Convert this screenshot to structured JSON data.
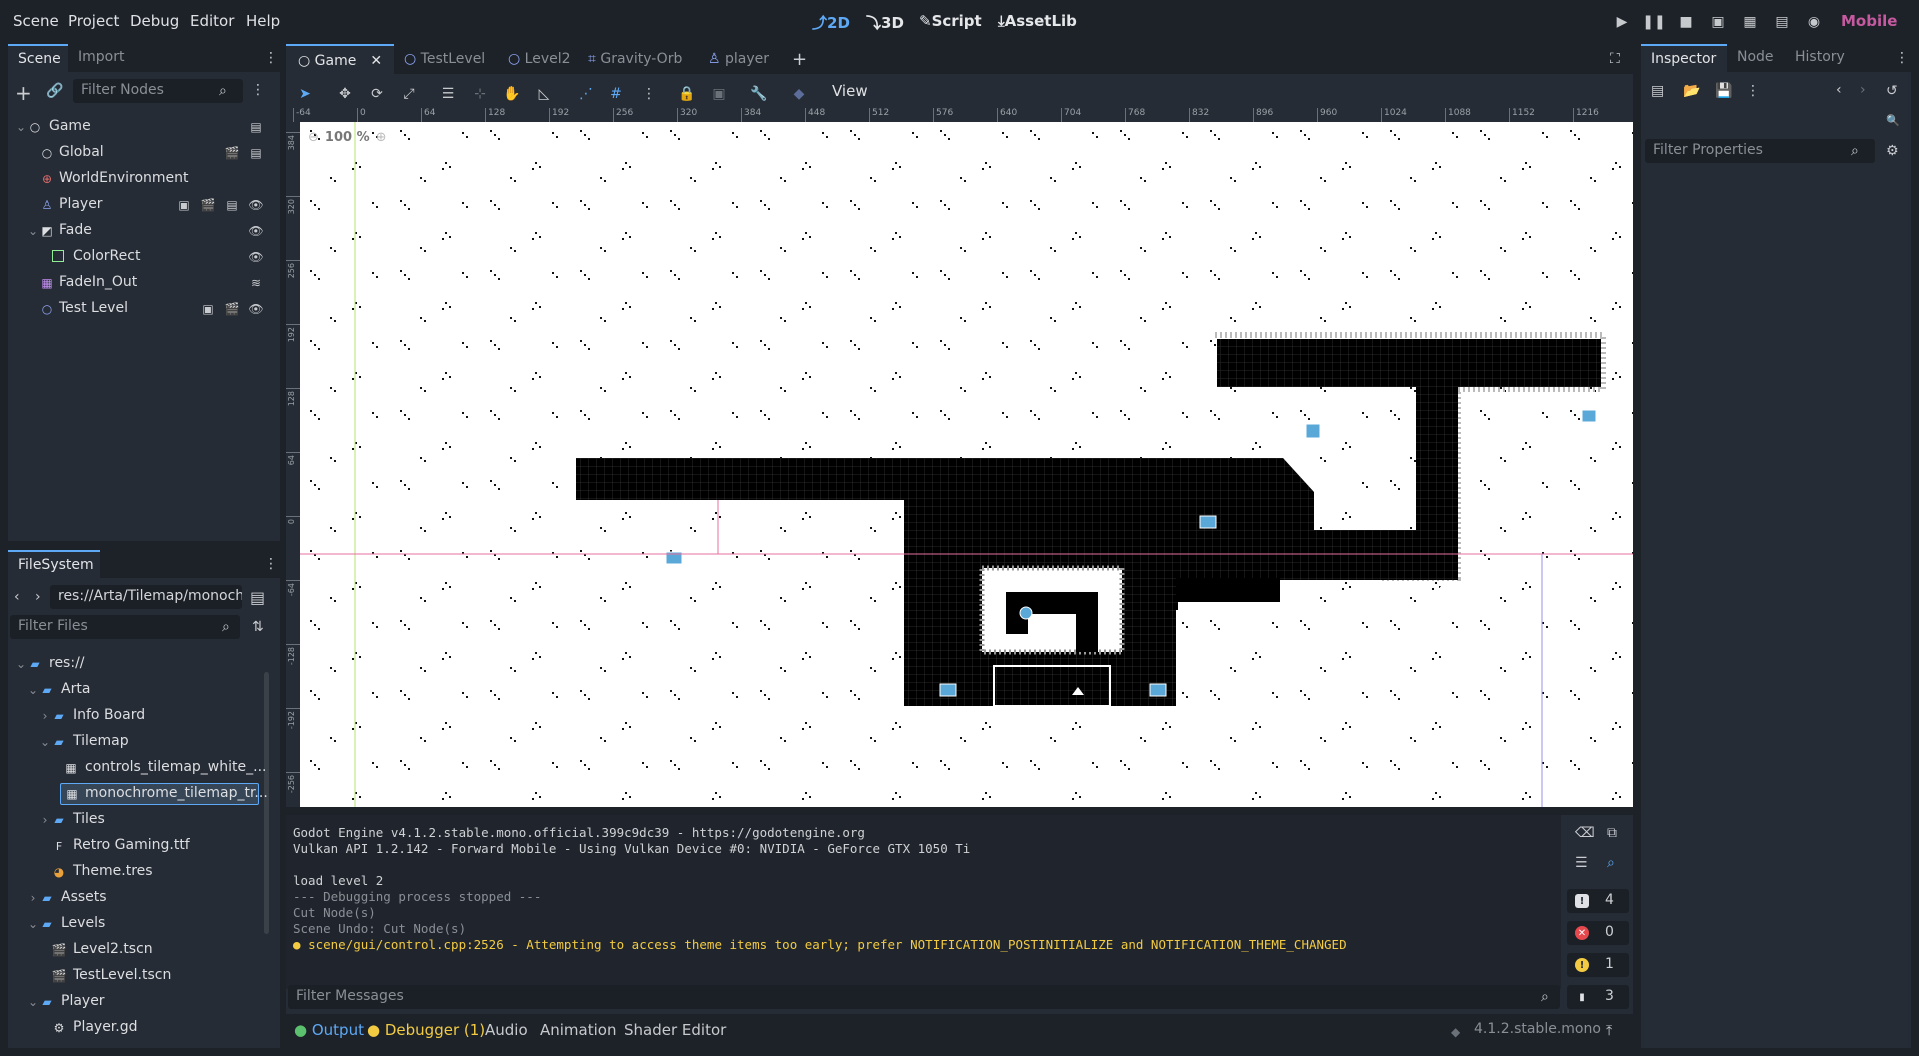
{
  "menu": [
    "Scene",
    "Project",
    "Debug",
    "Editor",
    "Help"
  ],
  "workspaces": {
    "w2d": "2D",
    "w3d": "3D",
    "script": "Script",
    "assetlib": "AssetLib"
  },
  "renderer": "Mobile",
  "scene_dock": {
    "tabs": [
      "Scene",
      "Import"
    ],
    "filter_placeholder": "Filter Nodes",
    "nodes": [
      {
        "label": "Game",
        "depth": 0
      },
      {
        "label": "Global",
        "depth": 1
      },
      {
        "label": "WorldEnvironment",
        "depth": 1
      },
      {
        "label": "Player",
        "depth": 1
      },
      {
        "label": "Fade",
        "depth": 1
      },
      {
        "label": "ColorRect",
        "depth": 2
      },
      {
        "label": "FadeIn_Out",
        "depth": 1
      },
      {
        "label": "Test Level",
        "depth": 1
      }
    ]
  },
  "filesystem": {
    "tab": "FileSystem",
    "path": "res://Arta/Tilemap/monoch",
    "filter_placeholder": "Filter Files",
    "items": [
      {
        "label": "res://"
      },
      {
        "label": "Arta"
      },
      {
        "label": "Info Board"
      },
      {
        "label": "Tilemap"
      },
      {
        "label": "controls_tilemap_white_..."
      },
      {
        "label": "monochrome_tilemap_tr..."
      },
      {
        "label": "Tiles"
      },
      {
        "label": "Retro Gaming.ttf"
      },
      {
        "label": "Theme.tres"
      },
      {
        "label": "Assets"
      },
      {
        "label": "Levels"
      },
      {
        "label": "Level2.tscn"
      },
      {
        "label": "TestLevel.tscn"
      },
      {
        "label": "Player"
      },
      {
        "label": "Player.gd"
      }
    ]
  },
  "editor_tabs": [
    "Game",
    "TestLevel",
    "Level2",
    "Gravity-Orb",
    "player"
  ],
  "toolbar": {
    "view_label": "View"
  },
  "zoom": "100 %",
  "ruler": {
    "top": [
      "-64",
      "0",
      "64",
      "128",
      "192",
      "256",
      "320",
      "384",
      "448",
      "512",
      "576",
      "640",
      "704",
      "768",
      "832",
      "896",
      "960",
      "1024",
      "1088",
      "1152",
      "1216"
    ],
    "left": [
      "384",
      "320",
      "256",
      "192",
      "128",
      "64",
      "0",
      "-64",
      "-128",
      "-192",
      "-256"
    ]
  },
  "inspector": {
    "tabs": [
      "Inspector",
      "Node",
      "History"
    ],
    "filter_placeholder": "Filter Properties"
  },
  "output": {
    "lines": [
      {
        "text": "Godot Engine v4.1.2.stable.mono.official.399c9dc39 - https://godotengine.org",
        "kind": "normal"
      },
      {
        "text": "Vulkan API 1.2.142 - Forward Mobile - Using Vulkan Device #0: NVIDIA - GeForce GTX 1050 Ti",
        "kind": "normal"
      },
      {
        "text": "",
        "kind": "normal"
      },
      {
        "text": "load level 2",
        "kind": "normal"
      },
      {
        "text": "--- Debugging process stopped ---",
        "kind": "dim"
      },
      {
        "text": "Cut Node(s)",
        "kind": "dim"
      },
      {
        "text": "Scene Undo: Cut Node(s)",
        "kind": "dim"
      },
      {
        "text": "scene/gui/control.cpp:2526 - Attempting to access theme items too early; prefer NOTIFICATION_POSTINITIALIZE and NOTIFICATION_THEME_CHANGED",
        "kind": "warning"
      }
    ],
    "filter_placeholder": "Filter Messages",
    "counters": {
      "messages": "4",
      "errors": "0",
      "warnings": "1",
      "editor": "3"
    }
  },
  "bottom_tabs": [
    "Output",
    "Debugger (1)",
    "Audio",
    "Animation",
    "Shader Editor"
  ],
  "version": "4.1.2.stable.mono",
  "colors": {
    "accent": "#5ea9f5",
    "warning": "#f2cb42",
    "error": "#e5484d",
    "renderer": "#c65aa0"
  }
}
